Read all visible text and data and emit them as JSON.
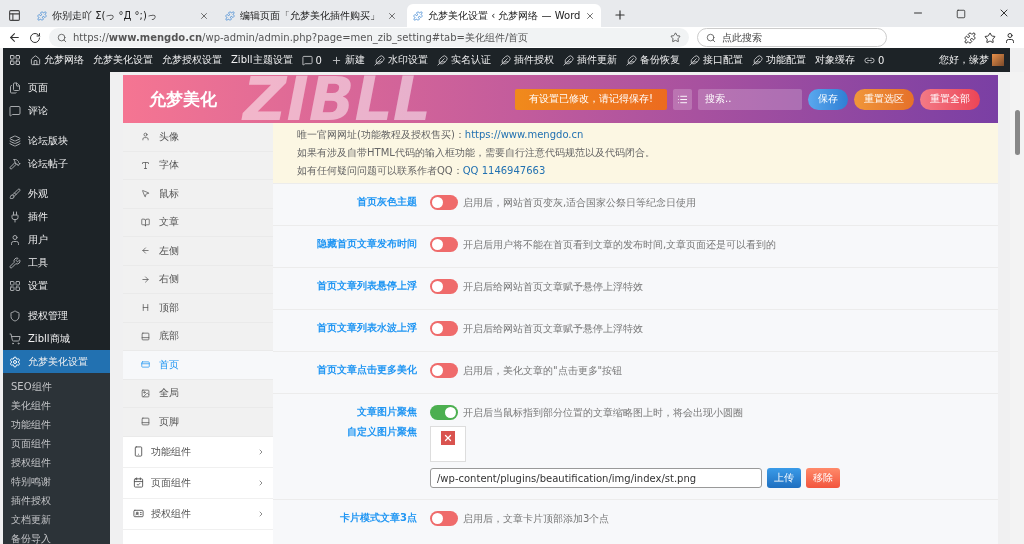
{
  "browser": {
    "tabs": [
      {
        "title": "你别走吖 Σ(っ °Д °;)っ",
        "selected": false
      },
      {
        "title": "编辑页面「允梦美化插件购买」",
        "selected": false
      },
      {
        "title": "允梦美化设置 ‹ 允梦网络 — Word",
        "selected": true
      }
    ],
    "url": "https://**www.mengdo.cn**/wp-admin/admin.php?page=men_zib_setting#tab=美化组件/首页",
    "search_placeholder": "点此搜索"
  },
  "admin_bar": {
    "items": [
      "允梦网络",
      "允梦美化设置",
      "允梦授权设置",
      "Zibll主题设置",
      "0",
      "新建",
      "水印设置",
      "实名认证",
      "插件授权",
      "插件更新",
      "备份恢复",
      "接口配置",
      "功能配置",
      "对象缓存",
      "0"
    ],
    "greeting": "您好，缘梦"
  },
  "sidebar": {
    "groups": [
      [
        {
          "label": "页面",
          "selected": false
        },
        {
          "label": "评论",
          "selected": false
        }
      ],
      [
        {
          "label": "论坛版块",
          "selected": false
        },
        {
          "label": "论坛帖子",
          "selected": false
        }
      ],
      [
        {
          "label": "外观",
          "selected": false
        },
        {
          "label": "插件",
          "selected": false
        },
        {
          "label": "用户",
          "selected": false
        },
        {
          "label": "工具",
          "selected": false
        },
        {
          "label": "设置",
          "selected": false
        }
      ],
      [
        {
          "label": "授权管理",
          "selected": false
        },
        {
          "label": "Zibll商城",
          "selected": false
        },
        {
          "label": "允梦美化设置",
          "selected": true
        }
      ]
    ],
    "submenu": [
      "SEO组件",
      "美化组件",
      "功能组件",
      "页面组件",
      "授权组件",
      "特别鸣谢",
      "插件授权",
      "文档更新",
      "备份导入"
    ]
  },
  "header": {
    "title": "允梦美化",
    "backdrop_text": "ZIBLL",
    "notice": "有设置已修改，请记得保存!",
    "search_placeholder": "搜索..",
    "buttons": [
      "保存",
      "重置选区",
      "重置全部"
    ]
  },
  "subnav": {
    "items": [
      {
        "label": "头像",
        "selected": false
      },
      {
        "label": "字体",
        "selected": false
      },
      {
        "label": "鼠标",
        "selected": false
      },
      {
        "label": "文章",
        "selected": false
      },
      {
        "label": "左侧",
        "selected": false
      },
      {
        "label": "右侧",
        "selected": false
      },
      {
        "label": "顶部",
        "selected": false
      },
      {
        "label": "底部",
        "selected": false
      },
      {
        "label": "首页",
        "selected": true
      },
      {
        "label": "全局",
        "selected": false
      },
      {
        "label": "页脚",
        "selected": false
      }
    ],
    "groups": [
      "功能组件",
      "页面组件",
      "授权组件"
    ]
  },
  "notice": {
    "lines": [
      {
        "text": "唯一官网网址(功能教程及授权售买)：",
        "link": "https://www.mengdo.cn"
      },
      {
        "text": "如果有涉及自带HTML代码的输入框功能，需要自行注意代码规范以及代码闭合。"
      },
      {
        "text": "如有任何疑问问题可以联系作者QQ：",
        "link": "QQ 1146947663"
      }
    ]
  },
  "settings": [
    {
      "kind": "toggle",
      "label": "首页灰色主题",
      "on": false,
      "description": "启用后，网站首页变灰,适合国家公祭日等纪念日使用"
    },
    {
      "kind": "toggle",
      "label": "隐藏首页文章发布时间",
      "on": false,
      "description": "开启后用户将不能在首页看到文章的发布时间,文章页面还是可以看到的"
    },
    {
      "kind": "toggle",
      "label": "首页文章列表悬停上浮",
      "on": false,
      "description": "开启后给网站首页文章赋予悬停上浮特效"
    },
    {
      "kind": "toggle",
      "label": "首页文章列表水波上浮",
      "on": false,
      "description": "开启后给网站首页文章赋予悬停上浮特效"
    },
    {
      "kind": "toggle",
      "label": "首页文章点击更多美化",
      "on": false,
      "description": "启用后，美化文章的\"点击更多\"按钮"
    },
    {
      "kind": "toggle_upload",
      "label": "文章图片聚焦",
      "on": true,
      "description": "开启后当鼠标指到部分位置的文章缩略图上时，将会出现小圆圈",
      "upload_label": "自定义图片聚焦",
      "value": "/wp-content/plugins/beautification/img/index/st.png",
      "buttons": [
        "上传",
        "移除"
      ]
    },
    {
      "kind": "toggle",
      "label": "卡片模式文章3点",
      "on": false,
      "description": "启用后，文章卡片顶部添加3个点"
    }
  ]
}
